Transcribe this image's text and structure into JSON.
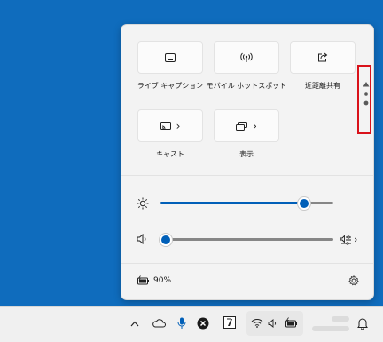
{
  "quick_settings": {
    "tiles": [
      {
        "label": "ライブ キャプション"
      },
      {
        "label": "モバイル ホットスポット"
      },
      {
        "label": "近距離共有"
      },
      {
        "label": "キャスト"
      },
      {
        "label": "表示"
      }
    ],
    "pager_icon": "up-triangle-icon",
    "brightness": {
      "icon": "sun-icon",
      "value": 0.83
    },
    "volume": {
      "icon": "speaker-icon",
      "value": 0.0
    },
    "battery": {
      "icon": "battery-charging-icon",
      "percent": "90%"
    },
    "settings_icon": "gear-icon"
  },
  "taskbar": {
    "icons": [
      "chevron-up-icon",
      "onedrive-cloud-icon",
      "microphone-icon",
      "close-circle-icon",
      "app-icon",
      "wifi-icon",
      "speaker-icon",
      "battery-icon",
      "notification-bell-icon"
    ],
    "clock_blurred": true
  },
  "colors": {
    "accent": "#005fb8",
    "desktop": "#0f6cbd",
    "highlight": "#d9121a"
  }
}
